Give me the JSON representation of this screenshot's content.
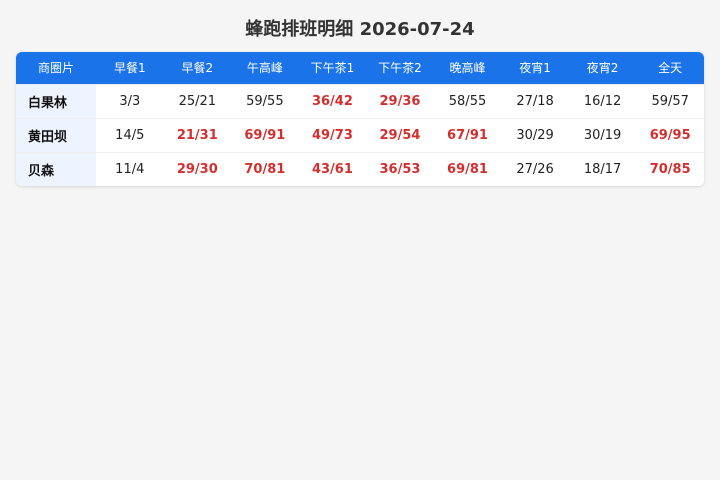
{
  "page": {
    "title": "蜂跑排班明细 2026-07-24"
  },
  "table": {
    "headers": [
      "商圈片",
      "早餐1",
      "早餐2",
      "午高峰",
      "下午茶1",
      "下午茶2",
      "晚高峰",
      "夜宵1",
      "夜宵2",
      "全天"
    ],
    "rows": [
      {
        "region": "白果林",
        "cells": [
          {
            "value": "3/3",
            "alert": false
          },
          {
            "value": "25/21",
            "alert": false
          },
          {
            "value": "59/55",
            "alert": false
          },
          {
            "value": "36/42",
            "alert": true
          },
          {
            "value": "29/36",
            "alert": true
          },
          {
            "value": "58/55",
            "alert": false
          },
          {
            "value": "27/18",
            "alert": false
          },
          {
            "value": "16/12",
            "alert": false
          },
          {
            "value": "59/57",
            "alert": false
          }
        ]
      },
      {
        "region": "黄田坝",
        "cells": [
          {
            "value": "14/5",
            "alert": false
          },
          {
            "value": "21/31",
            "alert": true
          },
          {
            "value": "69/91",
            "alert": true
          },
          {
            "value": "49/73",
            "alert": true
          },
          {
            "value": "29/54",
            "alert": true
          },
          {
            "value": "67/91",
            "alert": true
          },
          {
            "value": "30/29",
            "alert": false
          },
          {
            "value": "30/19",
            "alert": false
          },
          {
            "value": "69/95",
            "alert": true
          }
        ]
      },
      {
        "region": "贝森",
        "cells": [
          {
            "value": "11/4",
            "alert": false
          },
          {
            "value": "29/30",
            "alert": true
          },
          {
            "value": "70/81",
            "alert": true
          },
          {
            "value": "43/61",
            "alert": true
          },
          {
            "value": "36/53",
            "alert": true
          },
          {
            "value": "69/81",
            "alert": true
          },
          {
            "value": "27/26",
            "alert": false
          },
          {
            "value": "18/17",
            "alert": false
          },
          {
            "value": "70/85",
            "alert": true
          }
        ]
      }
    ]
  },
  "colors": {
    "header_bg": "#1a73e8",
    "alert_text": "#d32f2f",
    "region_bg": "#eef4ff",
    "page_bg": "#f5f5f5"
  }
}
